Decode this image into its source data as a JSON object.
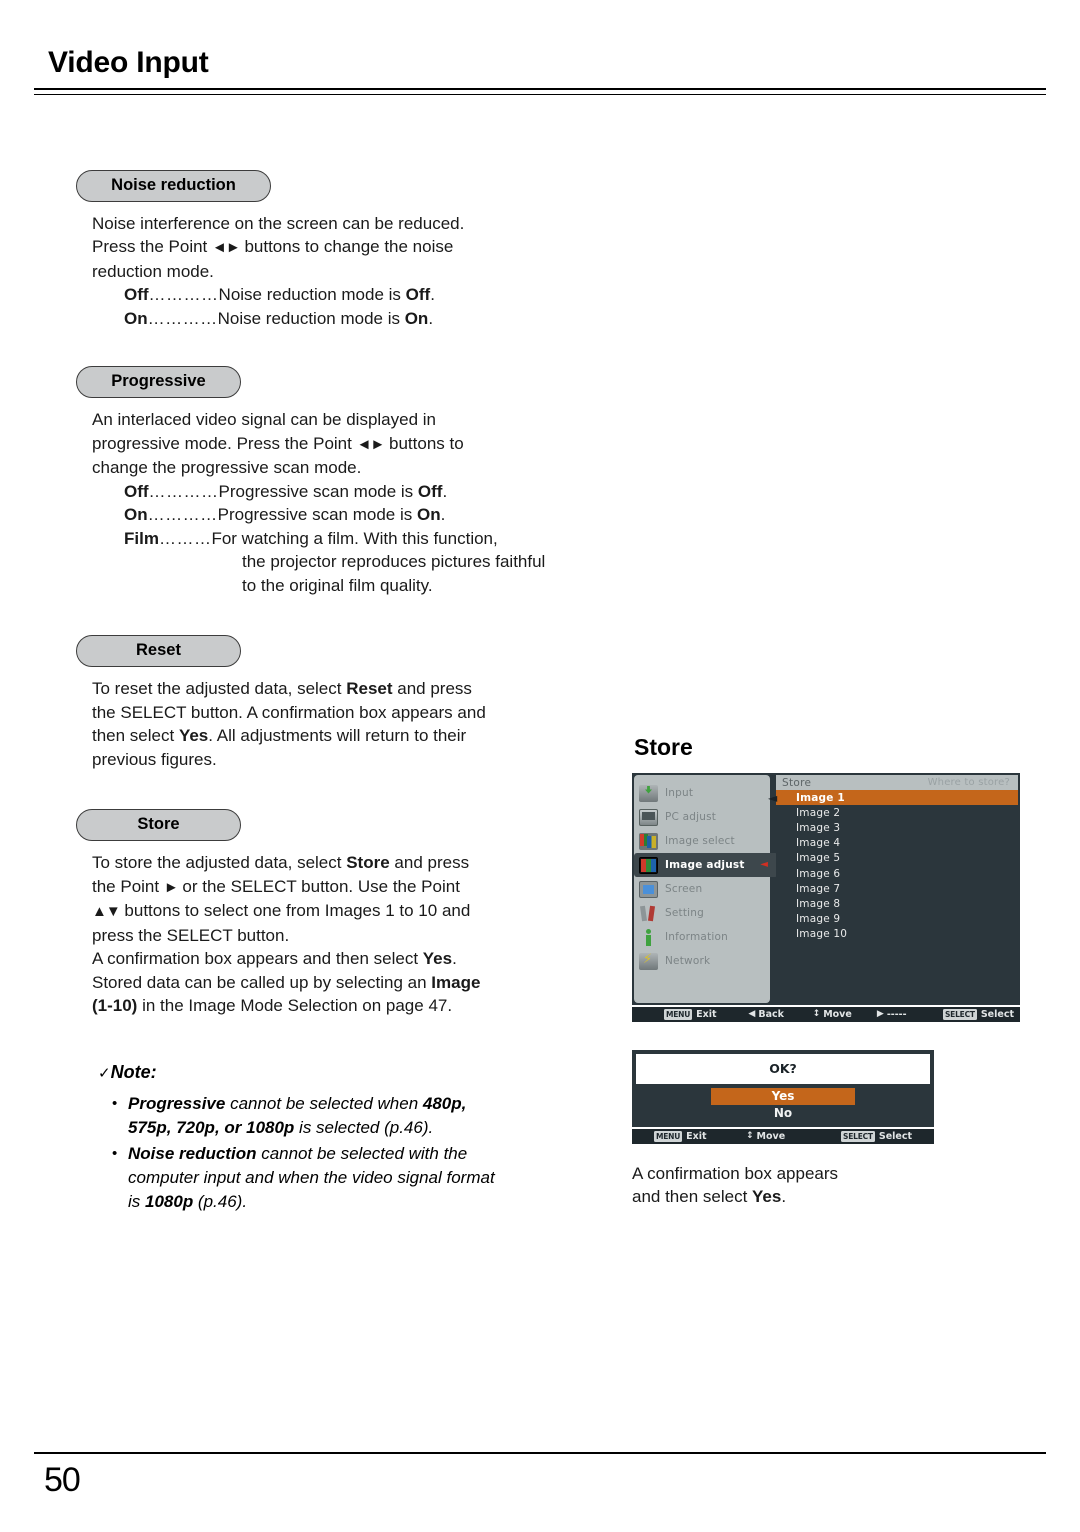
{
  "header": {
    "title": "Video Input"
  },
  "sections": {
    "noise_reduction": {
      "heading": "Noise reduction",
      "paragraph": "Noise interference on the screen can be reduced. Press the Point ◄► buttons to change the noise reduction mode.",
      "line1": "Noise interference on the screen can be reduced.",
      "line2a": "Press the Point ",
      "line2arrows": "◄►",
      "line2b": " buttons to change the noise",
      "line3": "reduction mode.",
      "definitions": [
        {
          "term": "Off",
          "dots": "…………",
          "pre": "Noise reduction mode is ",
          "bold": "Off",
          "post": "."
        },
        {
          "term": "On",
          "dots": "…………",
          "pre": "Noise reduction mode is ",
          "bold": "On",
          "post": "."
        }
      ]
    },
    "progressive": {
      "heading": "Progressive",
      "line1": "An interlaced video signal can be displayed in",
      "line2a": "progressive mode. Press the Point ",
      "line2arrows": "◄►",
      "line2b": " buttons to",
      "line3": "change the progressive scan mode.",
      "definitions": [
        {
          "term": "Off",
          "dots": "…………",
          "pre": "Progressive scan mode is ",
          "bold": "Off",
          "post": "."
        },
        {
          "term": "On",
          "dots": "…………",
          "pre": "Progressive scan mode is ",
          "bold": "On",
          "post": "."
        },
        {
          "term": "Film",
          "dots": "………",
          "pre": "For watching a film. With this function,",
          "bold": "",
          "post": ""
        }
      ],
      "film_cont1": "the projector reproduces pictures faithful",
      "film_cont2": "to the original film quality."
    },
    "reset": {
      "heading": "Reset",
      "l1a": "To reset the adjusted data, select ",
      "l1b": "Reset",
      "l1c": " and press",
      "l2": "the SELECT button. A confirmation box appears and",
      "l3a": "then select ",
      "l3b": "Yes",
      "l3c": ". All adjustments will return to their",
      "l4": "previous figures."
    },
    "store": {
      "heading": "Store",
      "l1a": "To store the adjusted data, select ",
      "l1b": "Store",
      "l1c": " and press",
      "l2a": "the Point ",
      "l2arrow": "►",
      "l2b": " or the SELECT button. Use the Point",
      "l3arrows": "▲▼",
      "l3b": " buttons to select one from Images 1 to 10 and",
      "l4": "press the SELECT button.",
      "l5a": "A confirmation box appears and then select ",
      "l5b": "Yes",
      "l5c": ".",
      "l6a": "Stored data can be called up by selecting an ",
      "l6b": "Image",
      "l7a": "(1-10)",
      "l7b": " in the Image Mode Selection on page 47."
    }
  },
  "note": {
    "check": "✓",
    "title": "Note:",
    "items": [
      {
        "bullet": "•",
        "l1a": "Progressive",
        "l1b": " cannot be selected when ",
        "l1c": "480p,",
        "l2a": "575p, 720p, or 1080p",
        "l2b": " is selected (p.46)."
      },
      {
        "bullet": "•",
        "l1a": "Noise reduction",
        "l1b": " cannot be selected with the",
        "l2a": "computer input and when the video signal format",
        "l3a": "is ",
        "l3b": "1080p",
        "l3c": " (p.46)."
      }
    ]
  },
  "osd": {
    "title": "Store",
    "sidebar": [
      {
        "label": "Input",
        "icon": "input-icon",
        "selected": false
      },
      {
        "label": "PC adjust",
        "icon": "monitor-icon",
        "selected": false
      },
      {
        "label": "Image select",
        "icon": "image-select-icon",
        "selected": false
      },
      {
        "label": "Image adjust",
        "icon": "image-adjust-icon",
        "selected": true,
        "arrow": "◄"
      },
      {
        "label": "Screen",
        "icon": "screen-icon",
        "selected": false
      },
      {
        "label": "Setting",
        "icon": "tools-icon",
        "selected": false
      },
      {
        "label": "Information",
        "icon": "info-icon",
        "selected": false
      },
      {
        "label": "Network",
        "icon": "network-icon",
        "selected": false
      }
    ],
    "pane": {
      "title": "Store",
      "prompt": "Where to store?",
      "cursor": "◄",
      "items": [
        {
          "label": "Image 1",
          "selected": true
        },
        {
          "label": "Image 2",
          "selected": false
        },
        {
          "label": "Image 3",
          "selected": false
        },
        {
          "label": "Image 4",
          "selected": false
        },
        {
          "label": "Image 5",
          "selected": false
        },
        {
          "label": "Image 6",
          "selected": false
        },
        {
          "label": "Image 7",
          "selected": false
        },
        {
          "label": "Image 8",
          "selected": false
        },
        {
          "label": "Image 9",
          "selected": false
        },
        {
          "label": "Image 10",
          "selected": false
        }
      ]
    },
    "footer": [
      {
        "key": "MENU",
        "glyph": "",
        "label": "Exit"
      },
      {
        "key": "",
        "glyph": "◀",
        "label": "Back"
      },
      {
        "key": "",
        "glyph": "↕",
        "label": "Move"
      },
      {
        "key": "",
        "glyph": "▶",
        "label": "-----"
      },
      {
        "key": "SELECT",
        "glyph": "",
        "label": "Select"
      }
    ]
  },
  "confirm": {
    "question": "OK?",
    "options": [
      {
        "label": "Yes",
        "selected": true
      },
      {
        "label": "No",
        "selected": false
      }
    ],
    "footer": [
      {
        "key": "MENU",
        "glyph": "",
        "label": "Exit"
      },
      {
        "key": "",
        "glyph": "↕",
        "label": "Move"
      },
      {
        "key": "SELECT",
        "glyph": "",
        "label": "Select"
      }
    ],
    "caption_l1": "A confirmation box appears",
    "caption_l2a": "and then select ",
    "caption_l2b": "Yes",
    "caption_l2c": "."
  },
  "footer": {
    "page_number": "50"
  },
  "colors": {
    "pill_fill": "#c9cbcc",
    "osd_bg": "#2b363c",
    "osd_sidebar": "#b8bfc0",
    "osd_highlight": "#c4661b",
    "osd_selected_row": "#3d474c",
    "arrow_red": "#d12f22"
  }
}
